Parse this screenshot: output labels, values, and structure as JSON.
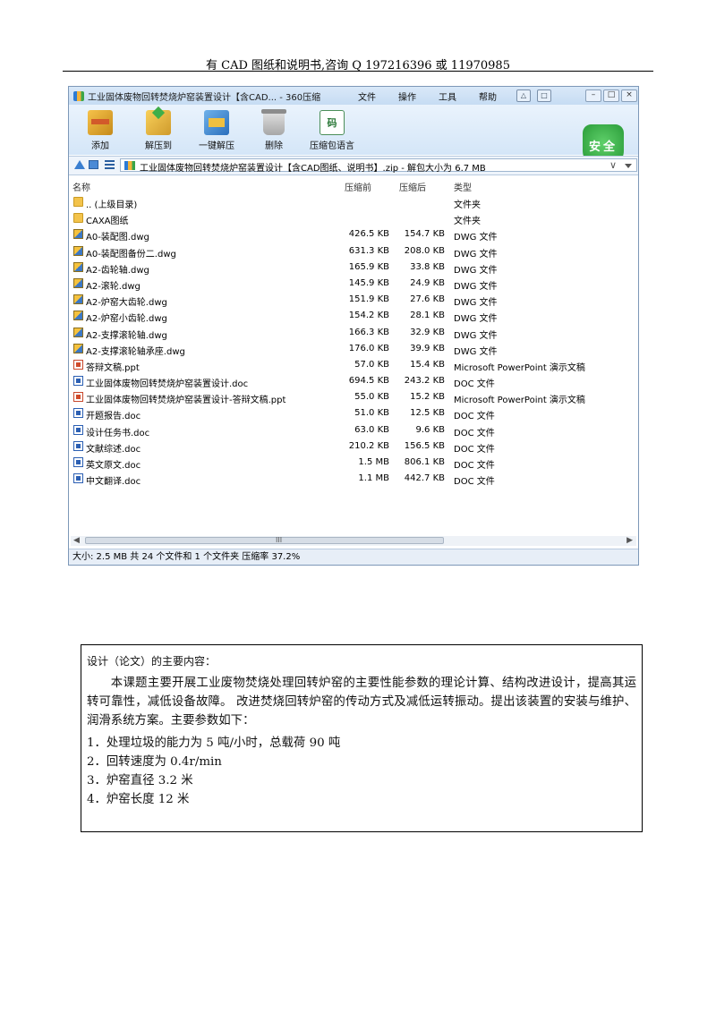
{
  "header": {
    "text": "有 CAD 图纸和说明书,咨询 Q 197216396  或  11970985"
  },
  "window": {
    "title": "工业固体废物回转焚烧炉窑装置设计【含CAD... - 360压缩",
    "menu": [
      "文件",
      "操作",
      "工具",
      "帮助"
    ],
    "toolbar": [
      {
        "label": "添加",
        "icon": "add-archive-icon"
      },
      {
        "label": "解压到",
        "icon": "extract-to-icon"
      },
      {
        "label": "一键解压",
        "icon": "one-click-extract-icon"
      },
      {
        "label": "删除",
        "icon": "trash-icon"
      },
      {
        "label": "压缩包语言",
        "icon": "archive-language-icon",
        "glyph": "码"
      }
    ],
    "safe_badge": "安全",
    "address": "工业固体废物回转焚烧炉窑装置设计【含CAD图纸、说明书】.zip - 解包大小为 6.7 MB",
    "columns": {
      "name": "名称",
      "orig": "压缩前",
      "comp": "压缩后",
      "type": "类型"
    },
    "files": [
      {
        "name": ".. (上级目录)",
        "orig": "",
        "comp": "",
        "type": "文件夹",
        "kind": "folder"
      },
      {
        "name": "CAXA图纸",
        "orig": "",
        "comp": "",
        "type": "文件夹",
        "kind": "folder"
      },
      {
        "name": "A0-装配图.dwg",
        "orig": "426.5 KB",
        "comp": "154.7 KB",
        "type": "DWG 文件",
        "kind": "dwg"
      },
      {
        "name": "A0-装配图备份二.dwg",
        "orig": "631.3 KB",
        "comp": "208.0 KB",
        "type": "DWG 文件",
        "kind": "dwg"
      },
      {
        "name": "A2-齿轮轴.dwg",
        "orig": "165.9 KB",
        "comp": "33.8 KB",
        "type": "DWG 文件",
        "kind": "dwg"
      },
      {
        "name": "A2-滚轮.dwg",
        "orig": "145.9 KB",
        "comp": "24.9 KB",
        "type": "DWG 文件",
        "kind": "dwg"
      },
      {
        "name": "A2-炉窑大齿轮.dwg",
        "orig": "151.9 KB",
        "comp": "27.6 KB",
        "type": "DWG 文件",
        "kind": "dwg"
      },
      {
        "name": "A2-炉窑小齿轮.dwg",
        "orig": "154.2 KB",
        "comp": "28.1 KB",
        "type": "DWG 文件",
        "kind": "dwg"
      },
      {
        "name": "A2-支撑滚轮轴.dwg",
        "orig": "166.3 KB",
        "comp": "32.9 KB",
        "type": "DWG 文件",
        "kind": "dwg"
      },
      {
        "name": "A2-支撑滚轮轴承座.dwg",
        "orig": "176.0 KB",
        "comp": "39.9 KB",
        "type": "DWG 文件",
        "kind": "dwg"
      },
      {
        "name": "答辩文稿.ppt",
        "orig": "57.0 KB",
        "comp": "15.4 KB",
        "type": "Microsoft PowerPoint 演示文稿",
        "kind": "ppt"
      },
      {
        "name": "工业固体废物回转焚烧炉窑装置设计.doc",
        "orig": "694.5 KB",
        "comp": "243.2 KB",
        "type": "DOC 文件",
        "kind": "doc"
      },
      {
        "name": "工业固体废物回转焚烧炉窑装置设计-答辩文稿.ppt",
        "orig": "55.0 KB",
        "comp": "15.2 KB",
        "type": "Microsoft PowerPoint 演示文稿",
        "kind": "ppt"
      },
      {
        "name": "开题报告.doc",
        "orig": "51.0 KB",
        "comp": "12.5 KB",
        "type": "DOC 文件",
        "kind": "doc"
      },
      {
        "name": "设计任务书.doc",
        "orig": "63.0 KB",
        "comp": "9.6 KB",
        "type": "DOC 文件",
        "kind": "doc"
      },
      {
        "name": "文献综述.doc",
        "orig": "210.2 KB",
        "comp": "156.5 KB",
        "type": "DOC 文件",
        "kind": "doc"
      },
      {
        "name": "英文原文.doc",
        "orig": "1.5 MB",
        "comp": "806.1 KB",
        "type": "DOC 文件",
        "kind": "doc"
      },
      {
        "name": "中文翻译.doc",
        "orig": "1.1 MB",
        "comp": "442.7 KB",
        "type": "DOC 文件",
        "kind": "doc"
      }
    ],
    "scroll_grip": "III",
    "status": "大小: 2.5 MB 共 24 个文件和 1 个文件夹 压缩率 37.2%"
  },
  "content": {
    "label": "设计（论文）的主要内容：",
    "paragraph": "本课题主要开展工业废物焚烧处理回转炉窑的主要性能参数的理论计算、结构改进设计，提高其运转可靠性，减低设备故障。   改进焚烧回转炉窑的传动方式及减低运转振动。提出该装置的安装与维护、润滑系统方案。主要参数如下：",
    "items": [
      "1．处理垃圾的能力为 5 吨/小时，总载荷 90 吨",
      "2．回转速度为 0.4r/min",
      "3．炉窑直径 3.2 米",
      "4．炉窑长度 12 米"
    ]
  }
}
